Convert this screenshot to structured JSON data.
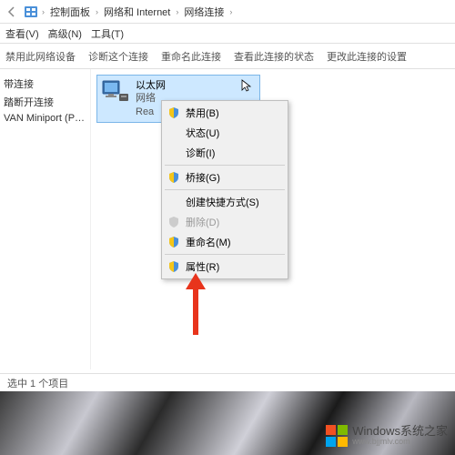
{
  "breadcrumb": {
    "root": "控制面板",
    "mid": "网络和 Internet",
    "leaf": "网络连接"
  },
  "menubar": {
    "view": "查看(V)",
    "advanced": "高级(N)",
    "tools": "工具(T)"
  },
  "toolbar": {
    "disable": "禁用此网络设备",
    "diagnose": "诊断这个连接",
    "rename": "重命名此连接",
    "status": "查看此连接的状态",
    "settings": "更改此连接的设置"
  },
  "sidebar": {
    "item1": "带连接",
    "item2": "踏断开连接",
    "item3": "VAN Miniport (PPPOE)"
  },
  "adapter": {
    "name": "以太网",
    "line2": "网络",
    "line3": "Rea"
  },
  "ctx": {
    "disable": "禁用(B)",
    "status": "状态(U)",
    "diagnose": "诊断(I)",
    "bridge": "桥接(G)",
    "shortcut": "创建快捷方式(S)",
    "delete": "删除(D)",
    "rename": "重命名(M)",
    "properties": "属性(R)"
  },
  "statusbar": "选中 1 个项目",
  "watermark": {
    "title": "Windows系统之家",
    "url": "www.bjjmlv.com"
  }
}
